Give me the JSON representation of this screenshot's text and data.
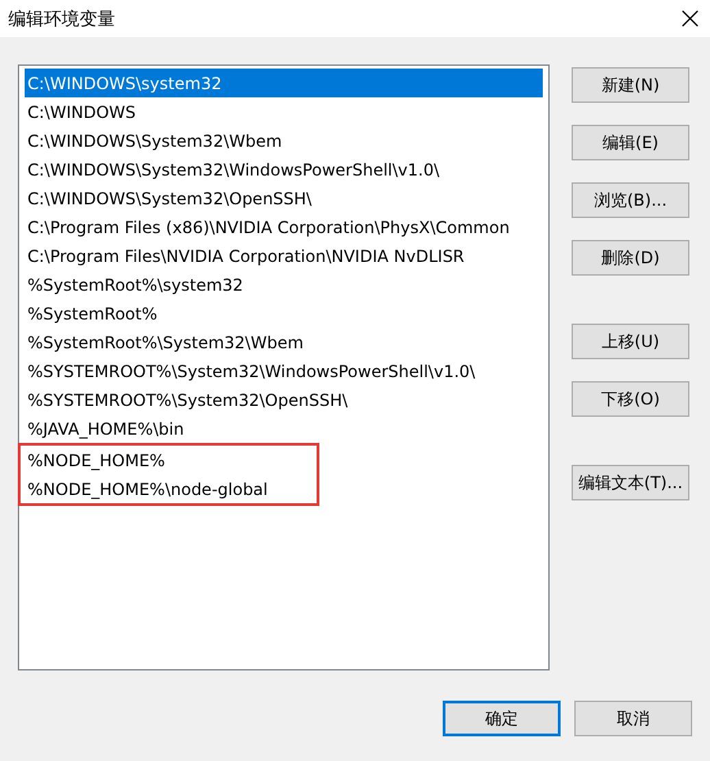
{
  "window": {
    "title": "编辑环境变量"
  },
  "paths": [
    {
      "text": "C:\\WINDOWS\\system32",
      "selected": true,
      "highlighted": false
    },
    {
      "text": "C:\\WINDOWS",
      "selected": false,
      "highlighted": false
    },
    {
      "text": "C:\\WINDOWS\\System32\\Wbem",
      "selected": false,
      "highlighted": false
    },
    {
      "text": "C:\\WINDOWS\\System32\\WindowsPowerShell\\v1.0\\",
      "selected": false,
      "highlighted": false
    },
    {
      "text": "C:\\WINDOWS\\System32\\OpenSSH\\",
      "selected": false,
      "highlighted": false
    },
    {
      "text": "C:\\Program Files (x86)\\NVIDIA Corporation\\PhysX\\Common",
      "selected": false,
      "highlighted": false
    },
    {
      "text": "C:\\Program Files\\NVIDIA Corporation\\NVIDIA NvDLISR",
      "selected": false,
      "highlighted": false
    },
    {
      "text": "%SystemRoot%\\system32",
      "selected": false,
      "highlighted": false
    },
    {
      "text": "%SystemRoot%",
      "selected": false,
      "highlighted": false
    },
    {
      "text": "%SystemRoot%\\System32\\Wbem",
      "selected": false,
      "highlighted": false
    },
    {
      "text": "%SYSTEMROOT%\\System32\\WindowsPowerShell\\v1.0\\",
      "selected": false,
      "highlighted": false
    },
    {
      "text": "%SYSTEMROOT%\\System32\\OpenSSH\\",
      "selected": false,
      "highlighted": false
    },
    {
      "text": "%JAVA_HOME%\\bin",
      "selected": false,
      "highlighted": false
    },
    {
      "text": "%NODE_HOME%",
      "selected": false,
      "highlighted": true
    },
    {
      "text": "%NODE_HOME%\\node-global",
      "selected": false,
      "highlighted": true
    }
  ],
  "side_button_groups": [
    {
      "buttons": [
        "新建(N)",
        "编辑(E)",
        "浏览(B)...",
        "删除(D)"
      ]
    },
    {
      "buttons": [
        "上移(U)",
        "下移(O)"
      ]
    },
    {
      "buttons": [
        "编辑文本(T)..."
      ]
    }
  ],
  "footer_buttons": [
    {
      "label": "确定",
      "default": true
    },
    {
      "label": "取消",
      "default": false
    }
  ]
}
